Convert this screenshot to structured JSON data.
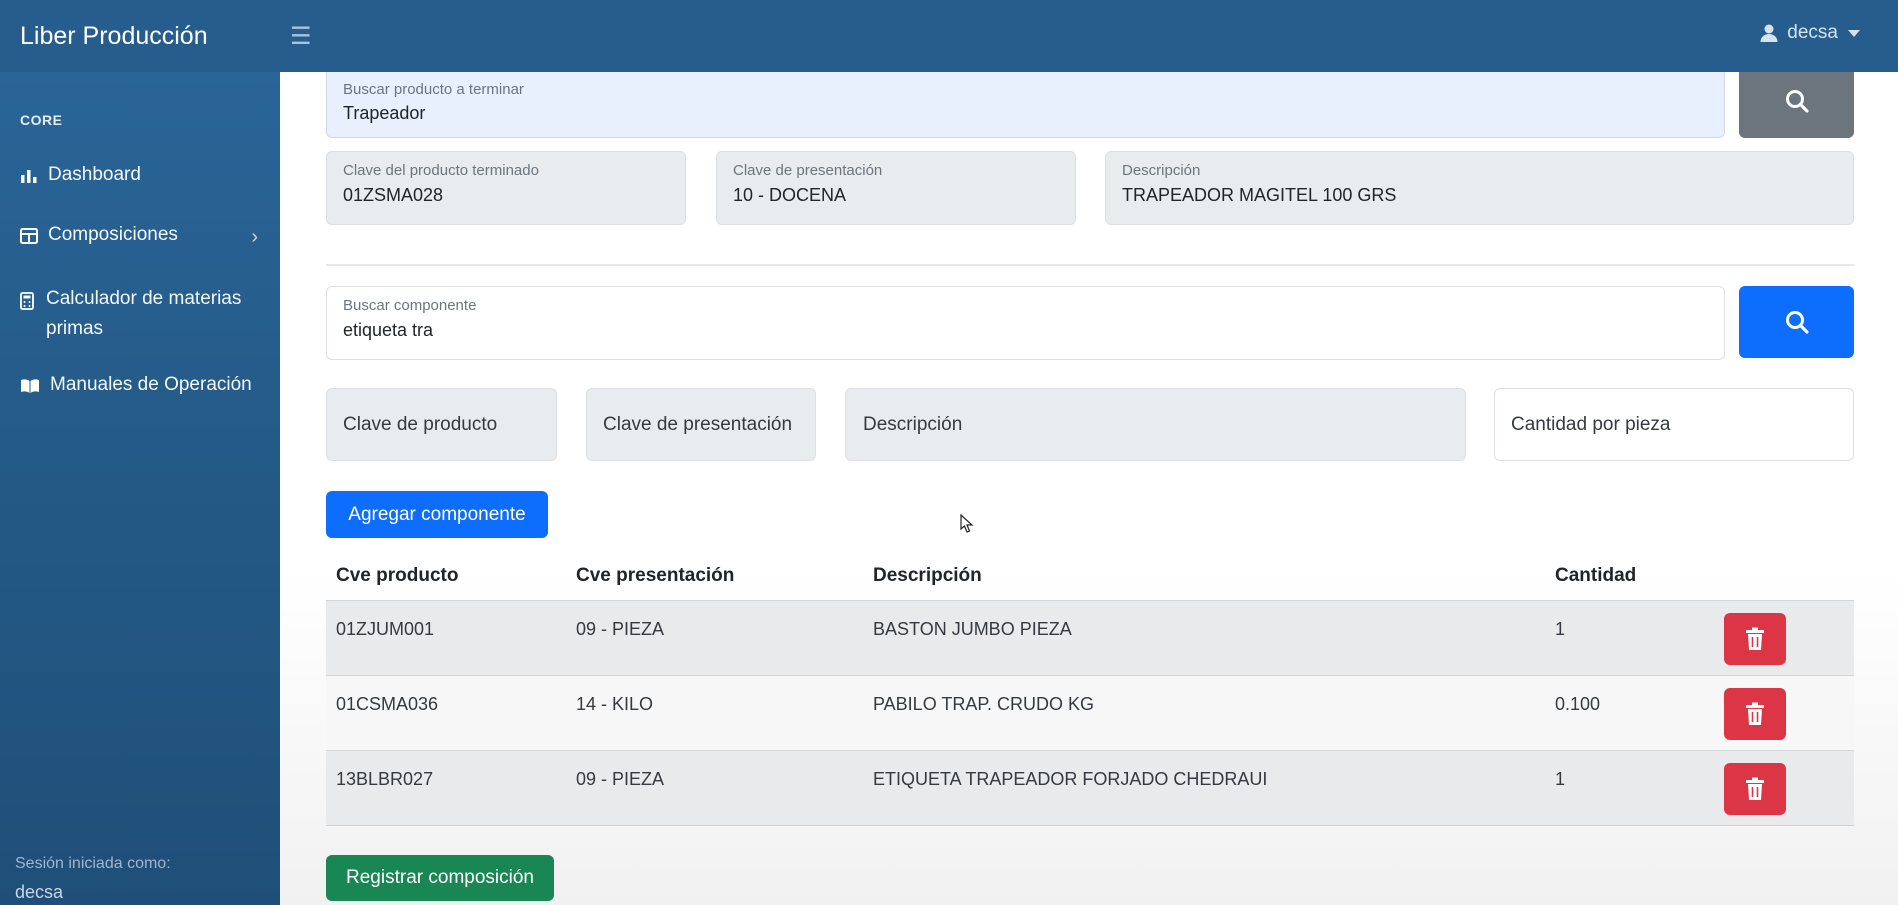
{
  "app": {
    "title": "Liber Producción",
    "user": "decsa"
  },
  "sidebar": {
    "heading": "CORE",
    "items": [
      {
        "label": "Dashboard",
        "icon": "bar-chart-icon"
      },
      {
        "label": "Composiciones",
        "icon": "columns-icon"
      },
      {
        "label": "Calculador de materias primas",
        "icon": "calculator-icon"
      },
      {
        "label": "Manuales de Operación",
        "icon": "book-icon"
      }
    ],
    "footer_label": "Sesión iniciada como:",
    "footer_user": "decsa"
  },
  "product_search": {
    "label": "Buscar producto a terminar",
    "value": "Trapeador"
  },
  "product_info": {
    "clave_label": "Clave del producto terminado",
    "clave_value": "01ZSMA028",
    "presentacion_label": "Clave de presentación",
    "presentacion_value": "10 - DOCENA",
    "descripcion_label": "Descripción",
    "descripcion_value": "TRAPEADOR MAGITEL 100 GRS"
  },
  "component_search": {
    "label": "Buscar componente",
    "value": "etiqueta tra"
  },
  "component_fields": {
    "clave_producto": "Clave de producto",
    "clave_presentacion": "Clave de presentación",
    "descripcion": "Descripción",
    "cantidad": "Cantidad por pieza"
  },
  "buttons": {
    "add": "Agregar componente",
    "register": "Registrar composición"
  },
  "table": {
    "headers": [
      "Cve producto",
      "Cve presentación",
      "Descripción",
      "Cantidad"
    ],
    "rows": [
      {
        "cve_producto": "01ZJUM001",
        "cve_presentacion": "09 - PIEZA",
        "descripcion": "BASTON JUMBO PIEZA",
        "cantidad": "1"
      },
      {
        "cve_producto": "01CSMA036",
        "cve_presentacion": "14 - KILO",
        "descripcion": "PABILO TRAP. CRUDO KG",
        "cantidad": "0.100"
      },
      {
        "cve_producto": "13BLBR027",
        "cve_presentacion": "09 - PIEZA",
        "descripcion": "ETIQUETA TRAPEADOR FORJADO CHEDRAUI",
        "cantidad": "1"
      }
    ]
  },
  "colors": {
    "navbar": "#265d8c",
    "primary": "#0d6efd",
    "danger": "#dc3545",
    "success": "#198754",
    "secondary": "#6c757d"
  }
}
